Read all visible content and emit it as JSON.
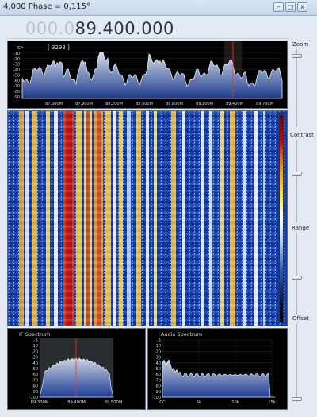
{
  "window": {
    "title": "4,000 Phase = 0,115°",
    "buttons": {
      "minimize": "–",
      "maximize": "□",
      "close": "x"
    }
  },
  "frequency_display": {
    "leading_digits": "000.0",
    "value_digits": "89.400.000"
  },
  "colors": {
    "spectrum_fill_top": "#c9d2de",
    "spectrum_fill_bottom": "#26408f",
    "waterfall_bg": "#0d2f9a",
    "marker": "#ff3030",
    "panel_bg": "#000000",
    "label_text": "#d6dbe0"
  },
  "spectrum": {
    "top_left_text": ">",
    "bandwidth_label": "[ 3293 ]",
    "y_ticks": [
      "-5",
      "-10",
      "-20",
      "-30",
      "-40",
      "-50",
      "-60",
      "-70",
      "-80",
      "-90"
    ],
    "x_ticks": [
      "87,600M",
      "87,900M",
      "88,200M",
      "88,500M",
      "88,800M",
      "89,100M",
      "89,400M",
      "89,700M"
    ],
    "selected_frequency": "89,400M"
  },
  "if_spectrum": {
    "title": "IF Spectrum",
    "y_ticks": [
      "-5",
      "-10",
      "-20",
      "-30",
      "-40",
      "-50",
      "-60",
      "-70",
      "-80",
      "-90",
      "-100"
    ],
    "x_ticks": [
      "89,300M",
      "89,400M",
      "89,500M"
    ]
  },
  "audio_spectrum": {
    "title": "Audio Spectrum",
    "y_ticks": [
      "-5",
      "-10",
      "-20",
      "-30",
      "-40",
      "-50",
      "-60",
      "-70",
      "-80",
      "-90",
      "-100"
    ],
    "x_ticks": [
      "DC",
      "5k",
      "10k",
      "15k"
    ]
  },
  "side_controls": {
    "zoom": {
      "label": "Zoom",
      "level": 0.08
    },
    "contrast": {
      "label": "Contrast",
      "level": 0.4
    },
    "range": {
      "label": "Range",
      "level": 0.55
    },
    "offset": {
      "label": "Offset",
      "level": 0.95
    }
  }
}
